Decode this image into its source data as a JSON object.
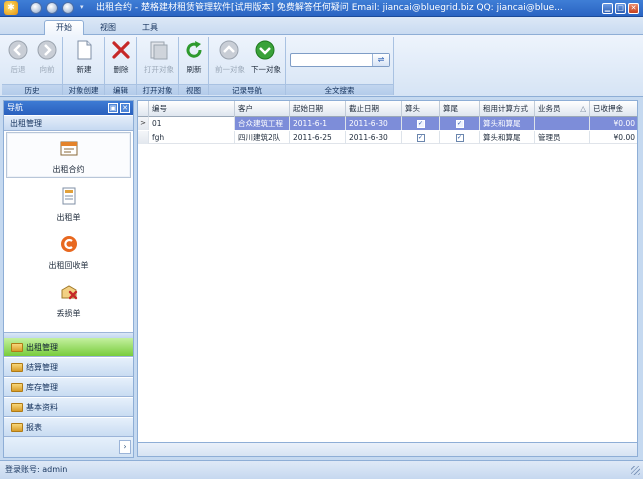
{
  "window": {
    "app_icon": "gear-icon",
    "title": "出租合约 - 楚格建材租赁管理软件[试用版本] 免费解答任何疑问 Email: jiancai@bluegrid.biz QQ: jiancai@blue...",
    "min": "▁",
    "max": "□",
    "close": "✕"
  },
  "tabs": {
    "app_menu": "▥▾",
    "items": [
      "开始",
      "视图",
      "工具"
    ],
    "collapse": "⌃"
  },
  "ribbon": {
    "history": {
      "label": "历史",
      "back": "后退",
      "forward": "向前"
    },
    "create": {
      "label": "对象创建",
      "new": "新建"
    },
    "edit": {
      "label": "编辑",
      "delete": "删除"
    },
    "open": {
      "label": "打开对象",
      "open_object": "打开对象"
    },
    "view": {
      "label": "视图",
      "refresh": "刷新"
    },
    "nav": {
      "label": "记录导航",
      "prev": "前一对象",
      "next": "下一对象"
    },
    "search": {
      "label": "全文搜索",
      "value": "",
      "go": "⇌"
    }
  },
  "nav": {
    "header": "导航",
    "pin": "▣",
    "close": "✕",
    "section": "出租管理",
    "items": [
      "出租合约",
      "出租单",
      "出租回收单",
      "丢损单"
    ],
    "bars": [
      "出租管理",
      "结算管理",
      "库存管理",
      "基本资料",
      "报表"
    ],
    "more": "›"
  },
  "grid": {
    "columns": [
      "编号",
      "客户",
      "起始日期",
      "截止日期",
      "算头",
      "算尾",
      "租用计算方式",
      "业务员",
      "已收押金"
    ],
    "sort_glyph": "△",
    "current_row_marker": ">",
    "check_mark": "✓",
    "rows": [
      {
        "id": "01",
        "customer": "合众建筑工程",
        "start": "2011-6-1",
        "end": "2011-6-30",
        "head": true,
        "tail": true,
        "method": "算头和算尾",
        "clerk": "",
        "deposit": "¥0.00"
      },
      {
        "id": "fgh",
        "customer": "四川建筑2队",
        "start": "2011-6-25",
        "end": "2011-6-30",
        "head": true,
        "tail": true,
        "method": "算头和算尾",
        "clerk": "管理员",
        "deposit": "¥0.00"
      }
    ]
  },
  "status": {
    "login": "登录账号: admin"
  },
  "colors": {
    "accent": "#2a64c2",
    "active_bar": "#78cc3c",
    "selection": "#7d8dd9"
  }
}
